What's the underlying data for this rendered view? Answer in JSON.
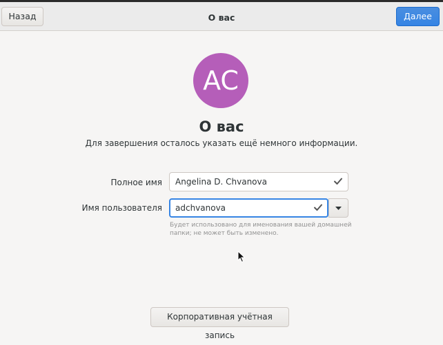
{
  "header": {
    "back_label": "Назад",
    "title": "О вас",
    "next_label": "Далее"
  },
  "avatar": {
    "initials": "AC",
    "color": "#b55eb9"
  },
  "page": {
    "heading": "О вас",
    "subtitle": "Для завершения осталось указать ещё немного информации."
  },
  "form": {
    "full_name_label": "Полное имя",
    "full_name_value": "Angelina D. Chvanova",
    "username_label": "Имя пользователя",
    "username_value": "adchvanova",
    "username_hint": "Будет использовано для именования вашей домашней папки; не может быть изменено."
  },
  "enterprise_button_label": "Корпоративная учётная запись",
  "colors": {
    "accent": "#3584e4",
    "background": "#f6f5f4",
    "header": "#ebebeb"
  },
  "icons": [
    "check-icon",
    "chevron-down-icon",
    "mouse-cursor-icon"
  ]
}
